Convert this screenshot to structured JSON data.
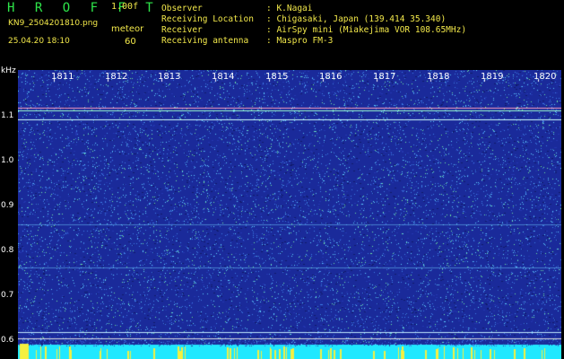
{
  "header": {
    "app_title": "H R O F F T",
    "version": "1.00f",
    "filename": "KN9_2504201810.png",
    "meteor_label": "meteor",
    "timestamp": "25.04.20 18:10",
    "meteor_count": "60"
  },
  "station_info": [
    {
      "label": "Observer",
      "value": ": K.Nagai"
    },
    {
      "label": "Receiving Location",
      "value": ": Chigasaki, Japan (139.414 35.340)"
    },
    {
      "label": "Receiver",
      "value": ": AirSpy mini (Miakejima VOR 108.65MHz)"
    },
    {
      "label": "Receiving antenna",
      "value": ": Maspro FM-3"
    }
  ],
  "spectrogram": {
    "frequency_unit": "kHz",
    "y_ticks": [
      "1.1",
      "1.0",
      "0.9",
      "0.8",
      "0.7",
      "0.6"
    ],
    "x_ticks": [
      "1811",
      "1812",
      "1813",
      "1814",
      "1815",
      "1816",
      "1817",
      "1818",
      "1819",
      "1820"
    ],
    "colors": {
      "background": "#1a2a9a",
      "noise": "#5fd0ff",
      "bottom_band": "#20e8ff",
      "carrier": "#ffffff"
    }
  }
}
